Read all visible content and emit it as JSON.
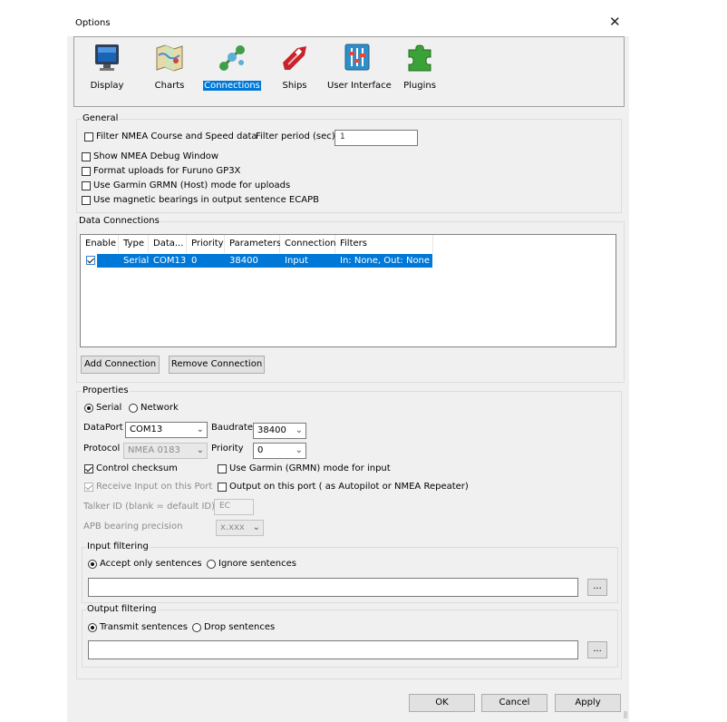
{
  "window": {
    "title": "Options",
    "close_glyph": "✕"
  },
  "toolbar": {
    "items": [
      {
        "label": "Display",
        "icon": "monitor-icon",
        "selected": false
      },
      {
        "label": "Charts",
        "icon": "chart-map-icon",
        "selected": false
      },
      {
        "label": "Connections",
        "icon": "connections-icon",
        "selected": true
      },
      {
        "label": "Ships",
        "icon": "ship-icon",
        "selected": false
      },
      {
        "label": "User Interface",
        "icon": "sliders-icon",
        "selected": false
      },
      {
        "label": "Plugins",
        "icon": "puzzle-icon",
        "selected": false
      }
    ]
  },
  "general": {
    "legend": "General",
    "filter_nmea": "Filter NMEA Course and Speed data",
    "filter_period_label": "Filter period (sec)",
    "filter_period_value": "1",
    "show_debug": "Show NMEA Debug Window",
    "format_uploads": "Format uploads for Furuno GP3X",
    "garmin_host": "Use Garmin GRMN (Host) mode for uploads",
    "magnetic_bearings": "Use magnetic bearings in output sentence ECAPB"
  },
  "data_connections": {
    "legend": "Data Connections",
    "columns": [
      "Enable",
      "Type",
      "Data...",
      "Priority",
      "Parameters",
      "Connection",
      "Filters"
    ],
    "rows": [
      {
        "enabled": true,
        "type": "Serial",
        "data": "COM13",
        "priority": "0",
        "parameters": "38400",
        "connection": "Input",
        "filters": "In: None, Out: None"
      }
    ],
    "add_button": "Add Connection",
    "remove_button": "Remove Connection"
  },
  "properties": {
    "legend": "Properties",
    "serial_label": "Serial",
    "network_label": "Network",
    "dataport_label": "DataPort",
    "dataport_value": "COM13",
    "baudrate_label": "Baudrate",
    "baudrate_value": "38400",
    "protocol_label": "Protocol",
    "protocol_value": "NMEA 0183",
    "priority_label": "Priority",
    "priority_value": "0",
    "control_checksum": "Control checksum",
    "garmin_input": "Use Garmin (GRMN) mode for input",
    "receive_input": "Receive Input on this Port",
    "output_port": "Output on this port ( as Autopilot or NMEA Repeater)",
    "talker_label": "Talker ID (blank = default ID)",
    "talker_value": "EC",
    "apb_label": "APB bearing precision",
    "apb_value": "x.xxx"
  },
  "input_filtering": {
    "legend": "Input filtering",
    "accept_label": "Accept only sentences",
    "ignore_label": "Ignore sentences",
    "browse": "..."
  },
  "output_filtering": {
    "legend": "Output filtering",
    "transmit_label": "Transmit sentences",
    "drop_label": "Drop sentences",
    "browse": "..."
  },
  "footer": {
    "ok": "OK",
    "cancel": "Cancel",
    "apply": "Apply"
  },
  "colors": {
    "selection": "#0078d7",
    "window_bg": "#f0f0f0"
  }
}
